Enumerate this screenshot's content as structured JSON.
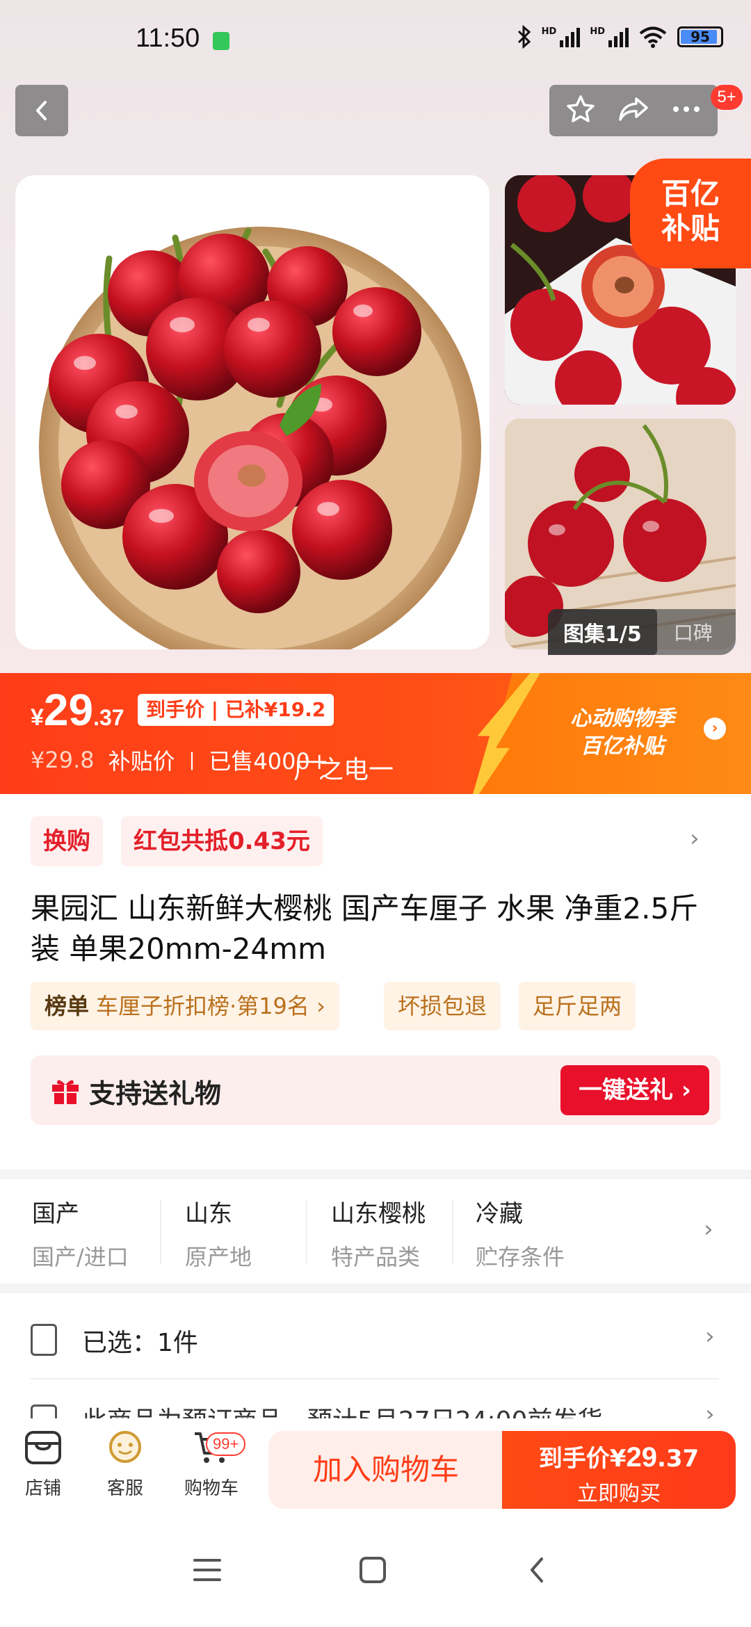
{
  "status_bar": {
    "time": "11:50",
    "signal_label_1": "HD",
    "signal_label_2": "HD",
    "battery": "95"
  },
  "top_nav": {
    "back_icon": "chevron-left-icon",
    "actions": [
      "star-icon",
      "share-icon",
      "more-icon"
    ],
    "notification_badge": "5+"
  },
  "gallery": {
    "subsidy_tag_line1": "百亿",
    "subsidy_tag_line2": "补贴",
    "counter": "图集1/5",
    "reviews_tab": "口碑"
  },
  "price_banner": {
    "currency": "¥",
    "price_int": "29",
    "price_dec": ".37",
    "final_price_tag": "到手价 | 已补¥19.2",
    "original_price": "¥29.8",
    "price_type": "补贴价",
    "divider": "|",
    "sold": "已售4000+",
    "watermark": "广之电一",
    "promo_line1": "心动购物季",
    "promo_line2": "百亿补贴",
    "promo_arrow": "›"
  },
  "info": {
    "chip_exchange": "换购",
    "chip_redpacket": "红包共抵0.43元",
    "title": "果园汇 山东新鲜大樱桃 国产车厘子 水果 净重2.5斤装 单果20mm-24mm",
    "rank_label": "榜单",
    "rank_text": "车厘子折扣榜·第19名 ›",
    "tag_damage": "坏损包退",
    "tag_weight": "足斤足两",
    "gift_label": "支持送礼物",
    "gift_button": "一键送礼 ›"
  },
  "attributes": [
    {
      "value": "国产",
      "key": "国产/进口"
    },
    {
      "value": "山东",
      "key": "原产地"
    },
    {
      "value": "山东樱桃",
      "key": "特产品类"
    },
    {
      "value": "冷藏",
      "key": "贮存条件"
    }
  ],
  "selection": {
    "selected": "已选：1件",
    "presale": "此商品为预订商品，预计5月27日24:00前发货"
  },
  "action_bar": {
    "store": "店铺",
    "service": "客服",
    "cart": "购物车",
    "cart_badge": "99+",
    "add_to_cart": "加入购物车",
    "buy_prefix": "到手价¥",
    "buy_price": "29",
    "buy_dec": ".37",
    "buy_now": "立即购买"
  },
  "colors": {
    "accent": "#ff3d18",
    "danger": "#e8102a",
    "tag_text": "#b9701c"
  }
}
